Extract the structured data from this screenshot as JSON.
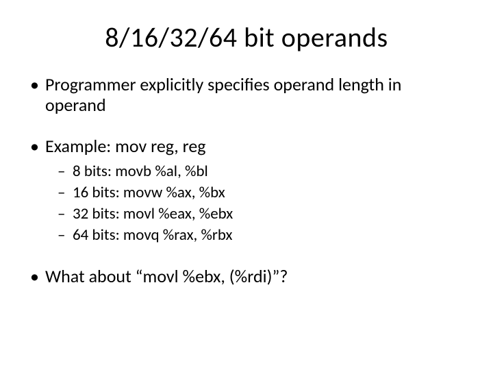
{
  "title": "8/16/32/64 bit operands",
  "bullets": {
    "b1": "Programmer explicitly specifies operand length in operand",
    "b2": "Example: mov reg, reg",
    "sub": {
      "s1": "8 bits: movb %al, %bl",
      "s2": "16 bits: movw %ax, %bx",
      "s3": "32 bits: movl %eax, %ebx",
      "s4": "64 bits: movq %rax, %rbx"
    },
    "b3": "What about “movl %ebx, (%rdi)”?"
  }
}
